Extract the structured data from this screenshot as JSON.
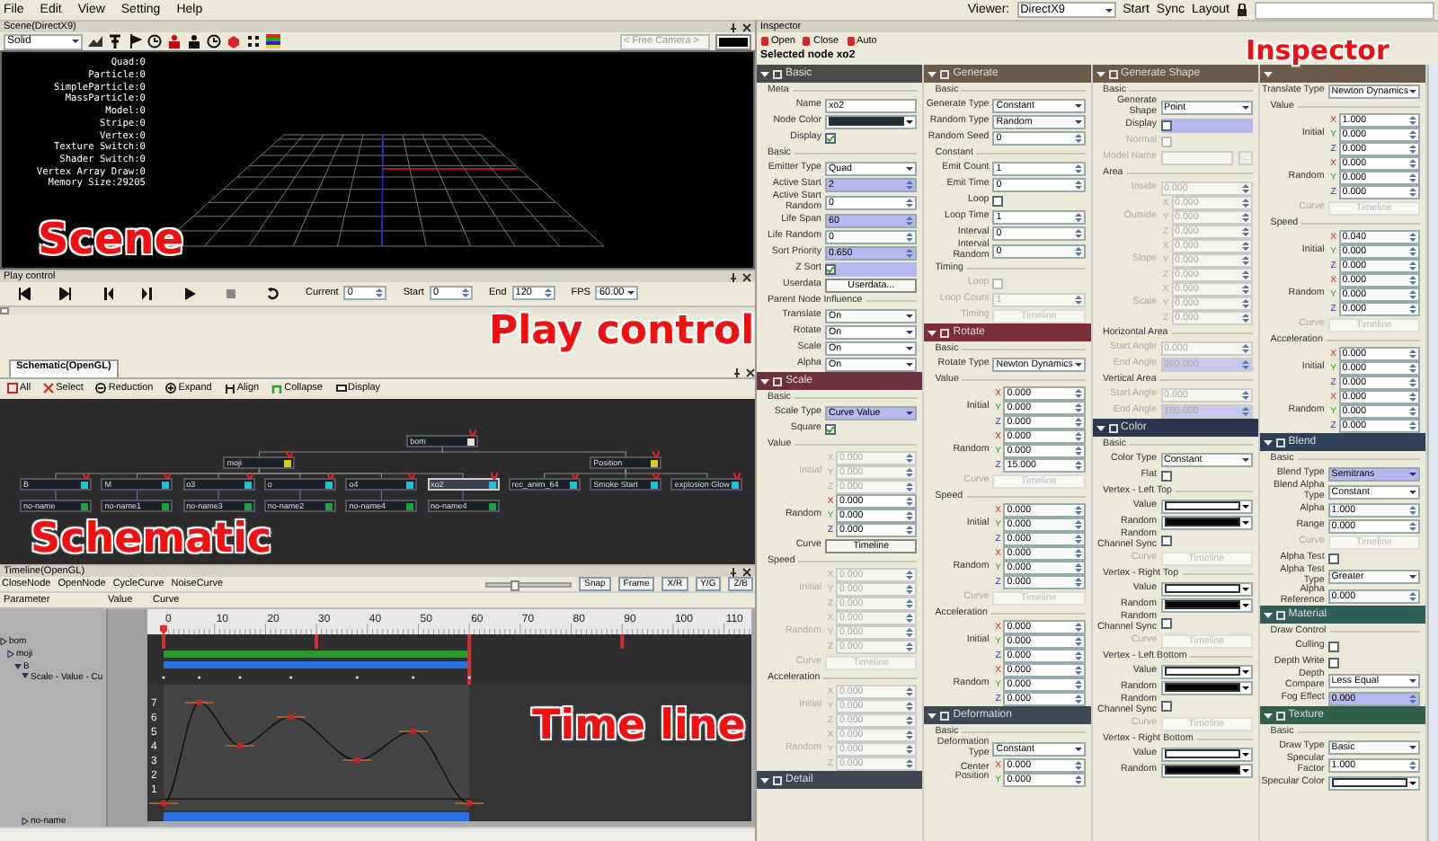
{
  "menu_bar": {
    "items": [
      "File",
      "Edit",
      "View",
      "Setting",
      "Help"
    ],
    "viewer_label": "Viewer:",
    "viewer": "DirectX9",
    "buttons": [
      "Start",
      "Sync",
      "Layout"
    ]
  },
  "scene": {
    "title": "Scene(DirectX9)",
    "shading": "Solid",
    "camera": "< Free Camera >",
    "annotation": "Scene",
    "stats": [
      "Quad:0",
      "Particle:0",
      "SimpleParticle:0",
      "MassParticle:0",
      "Model:0",
      "Stripe:0",
      "Vertex:0",
      "Texture Switch:0",
      "Shader Switch:0",
      "Vertex Array Draw:0",
      "Memory Size:29205"
    ]
  },
  "play_control": {
    "title": "Play control",
    "annotation": "Play control",
    "level": 0,
    "fields": [
      {
        "label": "Current",
        "value": "0"
      },
      {
        "label": "Start",
        "value": "0"
      },
      {
        "label": "End",
        "value": "120"
      },
      {
        "label": "FPS",
        "value": "60.00",
        "kind": "select"
      }
    ]
  },
  "schematic": {
    "tab": "Schematic(OpenGL)",
    "annotation": "Schematic",
    "tools": [
      "All",
      "Select",
      "Reduction",
      "Expand",
      "Align",
      "Collapse",
      "Display"
    ],
    "nodes": [
      {
        "label": "bom",
        "color": "#e0e0e0",
        "selected": false,
        "children": [
          {
            "label": "moji",
            "color": "#d8d020",
            "selected": false,
            "children": [
              {
                "label": "B",
                "color": "#20c0d0",
                "selected": false,
                "children": [
                  {
                    "label": "no-name",
                    "color": "#20a040",
                    "selected": false
                  }
                ]
              },
              {
                "label": "M",
                "color": "#20c0d0",
                "selected": false,
                "children": [
                  {
                    "label": "no-name1",
                    "color": "#20a040",
                    "selected": false
                  }
                ]
              },
              {
                "label": "o3",
                "color": "#20c0d0",
                "selected": false,
                "children": [
                  {
                    "label": "no-name3",
                    "color": "#20a040",
                    "selected": false
                  }
                ]
              },
              {
                "label": "o",
                "color": "#20c0d0",
                "selected": false,
                "children": [
                  {
                    "label": "no-name2",
                    "color": "#20a040",
                    "selected": false
                  }
                ]
              },
              {
                "label": "o4",
                "color": "#20c0d0",
                "selected": false,
                "children": [
                  {
                    "label": "no-name4",
                    "color": "#20a040",
                    "selected": false
                  }
                ]
              },
              {
                "label": "xo2",
                "color": "#20c0d0",
                "selected": true,
                "children": [
                  {
                    "label": "no-name4",
                    "color": "#20a040",
                    "selected": false
                  }
                ]
              }
            ]
          },
          {
            "label": "Position",
            "color": "#d8d020",
            "selected": false,
            "children": [
              {
                "label": "rec_anim_64",
                "color": "#20c0d0",
                "selected": false
              },
              {
                "label": "Smoke Start",
                "color": "#20c0d0",
                "selected": false
              },
              {
                "label": "explosion Glow",
                "color": "#20c0d0",
                "selected": false
              }
            ]
          }
        ]
      }
    ]
  },
  "timeline": {
    "title": "Timeline(OpenGL)",
    "annotation": "Time line",
    "tools": [
      "CloseNode",
      "OpenNode",
      "CycleCurve",
      "NoiseCurve"
    ],
    "zoom": {
      "level": 0.3
    },
    "toggles": [
      "Snap",
      "Frame",
      "X/R",
      "Y/G",
      "Z/B"
    ],
    "columns": [
      "Parameter",
      "Value",
      "Curve"
    ],
    "tree": [
      {
        "label": "bom",
        "kind": "node",
        "expanded": false,
        "children": [
          {
            "label": "moji",
            "kind": "node",
            "expanded": false,
            "children": [
              {
                "label": "B",
                "kind": "node",
                "expanded": true,
                "children": [
                  {
                    "label": "Scale - Value - Cu",
                    "kind": "curve",
                    "expanded": true
                  },
                  {
                    "label": "no-name",
                    "kind": "node",
                    "expanded": false
                  }
                ]
              }
            ]
          }
        ]
      }
    ],
    "ruler": [
      "0",
      "10",
      "20",
      "30",
      "40",
      "50",
      "60",
      "70",
      "80",
      "90",
      "100",
      "110"
    ],
    "curve_scale": [
      "7",
      "6",
      "5",
      "4",
      "3",
      "2",
      "1"
    ]
  },
  "inspector": {
    "title": "Inspector",
    "annotation": "Inspector",
    "tools": [
      "Open",
      "Close",
      "Auto"
    ],
    "selected_node": "Selected node xo2",
    "columns": [
      {
        "sections": [
          {
            "title": "Basic",
            "color": "#4a4a4a",
            "rows": [
              {
                "kind": "group",
                "label": "Meta"
              },
              {
                "kind": "text",
                "label": "Name",
                "value": "xo2"
              },
              {
                "kind": "color",
                "label": "Node Color",
                "color": "#1e2a35"
              },
              {
                "kind": "check",
                "label": "Display",
                "checked": true
              },
              {
                "kind": "group",
                "label": "Basic"
              },
              {
                "kind": "select",
                "label": "Emitter Type",
                "value": "Quad"
              },
              {
                "kind": "number",
                "label": "Active Start",
                "value": "2",
                "highlighted": true
              },
              {
                "kind": "number",
                "label": "Active Start Random",
                "value": "0"
              },
              {
                "kind": "number",
                "label": "Life Span",
                "value": "60",
                "highlighted": true
              },
              {
                "kind": "number",
                "label": "Life Random",
                "value": "0"
              },
              {
                "kind": "number",
                "label": "Sort Priority",
                "value": "0.650",
                "highlighted": true
              },
              {
                "kind": "check",
                "label": "Z Sort",
                "checked": true,
                "highlighted": true
              },
              {
                "kind": "button",
                "label": "Userdata",
                "button": "Userdata..."
              },
              {
                "kind": "group",
                "label": "Parent Node Influence"
              },
              {
                "kind": "select",
                "label": "Translate",
                "value": "On"
              },
              {
                "kind": "select",
                "label": "Rotate",
                "value": "On"
              },
              {
                "kind": "select",
                "label": "Scale",
                "value": "On"
              },
              {
                "kind": "select",
                "label": "Alpha",
                "value": "On"
              }
            ]
          },
          {
            "title": "Scale",
            "color": "#6e3040",
            "rows": [
              {
                "kind": "group",
                "label": "Basic"
              },
              {
                "kind": "select",
                "label": "Scale Type",
                "value": "Curve Value",
                "highlighted": true
              },
              {
                "kind": "check",
                "label": "Square",
                "checked": true
              },
              {
                "kind": "group",
                "label": "Value"
              },
              {
                "kind": "xyz",
                "label": "Initial",
                "axes": [
                  "X",
                  "Y",
                  "Z"
                ],
                "values": [
                  "0.000",
                  "0.000",
                  "0.000"
                ],
                "disabled": true
              },
              {
                "kind": "xyz",
                "label": "Random",
                "axes": [
                  "X",
                  "Y",
                  "Z"
                ],
                "values": [
                  "0.000",
                  "0.000",
                  "0.000"
                ]
              },
              {
                "kind": "button",
                "label": "Curve",
                "button": "Timeline"
              },
              {
                "kind": "group",
                "label": "Speed"
              },
              {
                "kind": "xyz",
                "label": "Initial",
                "axes": [
                  "X",
                  "Y",
                  "Z"
                ],
                "values": [
                  "0.000",
                  "0.000",
                  "0.000"
                ],
                "disabled": true
              },
              {
                "kind": "xyz",
                "label": "Random",
                "axes": [
                  "X",
                  "Y",
                  "Z"
                ],
                "values": [
                  "0.000",
                  "0.000",
                  "0.000"
                ],
                "disabled": true
              },
              {
                "kind": "button",
                "label": "Curve",
                "button": "Timeline",
                "disabled": true
              },
              {
                "kind": "group",
                "label": "Acceleration"
              },
              {
                "kind": "xyz",
                "label": "Initial",
                "axes": [
                  "X",
                  "Y",
                  "Z"
                ],
                "values": [
                  "0.000",
                  "0.000",
                  "0.000"
                ],
                "disabled": true
              },
              {
                "kind": "xyz",
                "label": "Random",
                "axes": [
                  "X",
                  "Y",
                  "Z"
                ],
                "values": [
                  "0.000",
                  "0.000",
                  "0.000"
                ],
                "disabled": true
              }
            ]
          },
          {
            "title": "Detail",
            "color": "#3d4650"
          }
        ]
      },
      {
        "sections": [
          {
            "title": "Generate",
            "color": "#6b5a48",
            "rows": [
              {
                "kind": "group",
                "label": "Basic"
              },
              {
                "kind": "select",
                "label": "Generate Type",
                "value": "Constant"
              },
              {
                "kind": "select",
                "label": "Random Type",
                "value": "Random"
              },
              {
                "kind": "number",
                "label": "Random Seed",
                "value": "0"
              },
              {
                "kind": "group",
                "label": "Constant"
              },
              {
                "kind": "number",
                "label": "Emit Count",
                "value": "1"
              },
              {
                "kind": "number",
                "label": "Emit Time",
                "value": "0"
              },
              {
                "kind": "check",
                "label": "Loop",
                "checked": false
              },
              {
                "kind": "number",
                "label": "Loop Time",
                "value": "1"
              },
              {
                "kind": "number",
                "label": "Interval",
                "value": "0"
              },
              {
                "kind": "number",
                "label": "Interval Random",
                "value": "0"
              },
              {
                "kind": "group",
                "label": "Timing"
              },
              {
                "kind": "check",
                "label": "Loop",
                "checked": false,
                "disabled": true
              },
              {
                "kind": "number",
                "label": "Loop Count",
                "value": "1",
                "disabled": true
              },
              {
                "kind": "button",
                "label": "Timing",
                "button": "Timeline",
                "disabled": true
              }
            ]
          },
          {
            "title": "Rotate",
            "color": "#7a2f3a",
            "rows": [
              {
                "kind": "group",
                "label": "Basic"
              },
              {
                "kind": "select",
                "label": "Rotate Type",
                "value": "Newton Dynamics"
              },
              {
                "kind": "group",
                "label": "Value"
              },
              {
                "kind": "xyz",
                "label": "Initial",
                "axes": [
                  "X",
                  "Y",
                  "Z"
                ],
                "values": [
                  "0.000",
                  "0.000",
                  "0.000"
                ]
              },
              {
                "kind": "xyz",
                "label": "Random",
                "axes": [
                  "X",
                  "Y",
                  "Z"
                ],
                "values": [
                  "0.000",
                  "0.000",
                  "15.000"
                ]
              },
              {
                "kind": "button",
                "label": "Curve",
                "button": "Timeline",
                "disabled": true
              },
              {
                "kind": "group",
                "label": "Speed"
              },
              {
                "kind": "xyz",
                "label": "Initial",
                "axes": [
                  "X",
                  "Y",
                  "Z"
                ],
                "values": [
                  "0.000",
                  "0.000",
                  "0.000"
                ]
              },
              {
                "kind": "xyz",
                "label": "Random",
                "axes": [
                  "X",
                  "Y",
                  "Z"
                ],
                "values": [
                  "0.000",
                  "0.000",
                  "0.000"
                ]
              },
              {
                "kind": "button",
                "label": "Curve",
                "button": "Timeline",
                "disabled": true
              },
              {
                "kind": "group",
                "label": "Acceleration"
              },
              {
                "kind": "xyz",
                "label": "Initial",
                "axes": [
                  "X",
                  "Y",
                  "Z"
                ],
                "values": [
                  "0.000",
                  "0.000",
                  "0.000"
                ]
              },
              {
                "kind": "xyz",
                "label": "Random",
                "axes": [
                  "X",
                  "Y",
                  "Z"
                ],
                "values": [
                  "0.000",
                  "0.000",
                  "0.000"
                ]
              }
            ]
          },
          {
            "title": "Deformation",
            "color": "#3d4a55",
            "rows": [
              {
                "kind": "group",
                "label": "Basic"
              },
              {
                "kind": "select",
                "label": "Deformation Type",
                "value": "Constant"
              },
              {
                "kind": "xyz",
                "label": "Center Position",
                "axes": [
                  "X",
                  "Y"
                ],
                "values": [
                  "0.000",
                  "0.000"
                ]
              }
            ]
          }
        ]
      },
      {
        "sections": [
          {
            "title": "Generate Shape",
            "color": "#6b5a48",
            "rows": [
              {
                "kind": "group",
                "label": "Basic"
              },
              {
                "kind": "select",
                "label": "Generate Shape",
                "value": "Point"
              },
              {
                "kind": "check",
                "label": "Display",
                "checked": false,
                "highlighted": true
              },
              {
                "kind": "check",
                "label": "Normal",
                "checked": false,
                "disabled": true
              },
              {
                "kind": "text",
                "label": "Model Name",
                "button": "...",
                "disabled": true
              },
              {
                "kind": "group",
                "label": "Area"
              },
              {
                "kind": "number",
                "label": "Inside",
                "value": "0.000",
                "disabled": true
              },
              {
                "kind": "xyz",
                "label": "Outside",
                "axes": [
                  "X",
                  "Y",
                  "Z"
                ],
                "values": [
                  "0.000",
                  "0.000",
                  "0.000"
                ],
                "disabled": true
              },
              {
                "kind": "xyz",
                "label": "Slope",
                "axes": [
                  "X",
                  "Y",
                  "Z"
                ],
                "values": [
                  "0.000",
                  "0.000",
                  "0.000"
                ],
                "disabled": true
              },
              {
                "kind": "xyz",
                "label": "Scale",
                "axes": [
                  "X",
                  "Y",
                  "Z"
                ],
                "values": [
                  "0.000",
                  "0.000",
                  "0.000"
                ],
                "disabled": true
              },
              {
                "kind": "group",
                "label": "Horizontal Area"
              },
              {
                "kind": "number",
                "label": "Start Angle",
                "value": "0.000",
                "disabled": true
              },
              {
                "kind": "number",
                "label": "End Angle",
                "value": "360.000",
                "disabled": true,
                "highlighted": true
              },
              {
                "kind": "group",
                "label": "Vertical Area"
              },
              {
                "kind": "number",
                "label": "Start Angle",
                "value": "0.000",
                "disabled": true
              },
              {
                "kind": "number",
                "label": "End Angle",
                "value": "180.000",
                "disabled": true,
                "highlighted": true
              }
            ]
          },
          {
            "title": "Color",
            "color": "#2b3550",
            "rows": [
              {
                "kind": "group",
                "label": "Basic"
              },
              {
                "kind": "select",
                "label": "Color Type",
                "value": "Constant"
              },
              {
                "kind": "check",
                "label": "Flat",
                "checked": false
              },
              {
                "kind": "group",
                "label": "Vertex - Left Top"
              },
              {
                "kind": "color",
                "label": "Value",
                "color": "#ffffff"
              },
              {
                "kind": "color",
                "label": "Random",
                "color": "#000000"
              },
              {
                "kind": "check",
                "label": "Random Channel Sync",
                "checked": false
              },
              {
                "kind": "button",
                "label": "Curve",
                "button": "Timeline",
                "disabled": true
              },
              {
                "kind": "group",
                "label": "Vertex - Right Top"
              },
              {
                "kind": "color",
                "label": "Value",
                "color": "#ffffff"
              },
              {
                "kind": "color",
                "label": "Random",
                "color": "#000000"
              },
              {
                "kind": "check",
                "label": "Random Channel Sync",
                "checked": false
              },
              {
                "kind": "button",
                "label": "Curve",
                "button": "Timeline",
                "disabled": true
              },
              {
                "kind": "group",
                "label": "Vertex - Left Bottom"
              },
              {
                "kind": "color",
                "label": "Value",
                "color": "#ffffff"
              },
              {
                "kind": "color",
                "label": "Random",
                "color": "#000000"
              },
              {
                "kind": "check",
                "label": "Random Channel Sync",
                "checked": false
              },
              {
                "kind": "button",
                "label": "Curve",
                "button": "Timeline",
                "disabled": true
              },
              {
                "kind": "group",
                "label": "Vertex - Right Bottom"
              },
              {
                "kind": "color",
                "label": "Value",
                "color": "#ffffff"
              },
              {
                "kind": "color",
                "label": "Random",
                "color": "#000000"
              }
            ]
          }
        ]
      },
      {
        "sections": [
          {
            "color": "#6b5a48",
            "rows": [
              {
                "kind": "select",
                "label": "Translate Type",
                "value": "Newton Dynamics"
              },
              {
                "kind": "group",
                "label": "Value"
              },
              {
                "kind": "xyz",
                "label": "Initial",
                "axes": [
                  "X",
                  "Y",
                  "Z"
                ],
                "values": [
                  "1.000",
                  "0.000",
                  "0.000"
                ]
              },
              {
                "kind": "xyz",
                "label": "Random",
                "axes": [
                  "X",
                  "Y",
                  "Z"
                ],
                "values": [
                  "0.000",
                  "0.000",
                  "0.000"
                ]
              },
              {
                "kind": "button",
                "label": "Curve",
                "button": "Timeline",
                "disabled": true
              },
              {
                "kind": "group",
                "label": "Speed"
              },
              {
                "kind": "xyz",
                "label": "Initial",
                "axes": [
                  "X",
                  "Y",
                  "Z"
                ],
                "values": [
                  "0.040",
                  "0.000",
                  "0.000"
                ]
              },
              {
                "kind": "xyz",
                "label": "Random",
                "axes": [
                  "X",
                  "Y",
                  "Z"
                ],
                "values": [
                  "0.000",
                  "0.000",
                  "0.000"
                ]
              },
              {
                "kind": "button",
                "label": "Curve",
                "button": "Timeline",
                "disabled": true
              },
              {
                "kind": "group",
                "label": "Acceleration"
              },
              {
                "kind": "xyz",
                "label": "Initial",
                "axes": [
                  "X",
                  "Y",
                  "Z"
                ],
                "values": [
                  "0.000",
                  "0.000",
                  "0.000"
                ]
              },
              {
                "kind": "xyz",
                "label": "Random",
                "axes": [
                  "X",
                  "Y",
                  "Z"
                ],
                "values": [
                  "0.000",
                  "0.000",
                  "0.000"
                ]
              }
            ]
          },
          {
            "title": "Blend",
            "color": "#2c4058",
            "rows": [
              {
                "kind": "group",
                "label": "Basic"
              },
              {
                "kind": "select",
                "label": "Blend Type",
                "value": "Semitrans",
                "highlighted": true
              },
              {
                "kind": "select",
                "label": "Blend Alpha Type",
                "value": "Constant"
              },
              {
                "kind": "number",
                "label": "Alpha",
                "value": "1.000"
              },
              {
                "kind": "number",
                "label": "Range",
                "value": "0.000"
              },
              {
                "kind": "button",
                "label": "Curve",
                "button": "Timeline",
                "disabled": true
              },
              {
                "kind": "check",
                "label": "Alpha Test",
                "checked": false
              },
              {
                "kind": "select",
                "label": "Alpha Test Type",
                "value": "Greater"
              },
              {
                "kind": "number",
                "label": "Alpha Reference",
                "value": "0.000"
              }
            ]
          },
          {
            "title": "Material",
            "color": "#2f5f58",
            "rows": [
              {
                "kind": "group",
                "label": "Draw Control"
              },
              {
                "kind": "check",
                "label": "Culling",
                "checked": false
              },
              {
                "kind": "check",
                "label": "Depth Write",
                "checked": false
              },
              {
                "kind": "select",
                "label": "Depth Compare",
                "value": "Less Equal"
              },
              {
                "kind": "number",
                "label": "Fog Effect",
                "value": "0.000",
                "highlighted": true
              }
            ]
          },
          {
            "title": "Texture",
            "color": "#2f6048",
            "rows": [
              {
                "kind": "group",
                "label": "Basic"
              },
              {
                "kind": "select",
                "label": "Draw Type",
                "value": "Basic"
              },
              {
                "kind": "number",
                "label": "Specular Factor",
                "value": "1.000"
              },
              {
                "kind": "color",
                "label": "Specular Color",
                "color": "#ffffff"
              }
            ]
          }
        ]
      }
    ]
  }
}
